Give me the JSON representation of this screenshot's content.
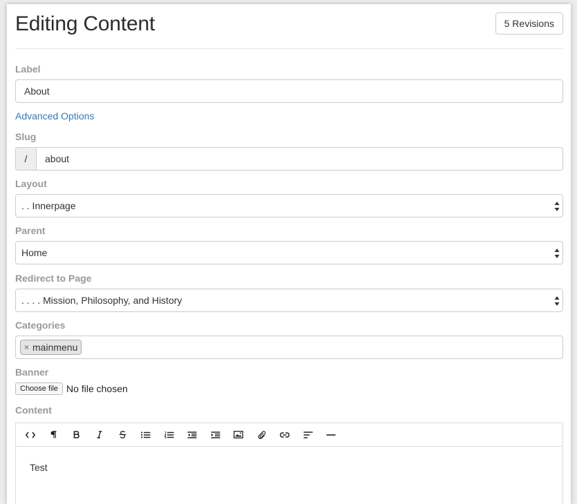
{
  "header": {
    "title": "Editing Content",
    "revisions_label": "5 Revisions"
  },
  "form": {
    "label": {
      "label": "Label",
      "value": "About"
    },
    "advanced_options": "Advanced Options",
    "slug": {
      "label": "Slug",
      "prefix": "/",
      "value": "about"
    },
    "layout": {
      "label": "Layout",
      "selected": ". . Innerpage"
    },
    "parent": {
      "label": "Parent",
      "selected": "Home"
    },
    "redirect": {
      "label": "Redirect to Page",
      "selected": ". . . . Mission, Philosophy, and History"
    },
    "categories": {
      "label": "Categories",
      "tags": [
        {
          "text": "mainmenu",
          "remove": "×"
        }
      ]
    },
    "banner": {
      "label": "Banner",
      "button": "Choose file",
      "status": "No file chosen"
    },
    "content": {
      "label": "Content",
      "body": "Test",
      "toolbar": [
        "code-icon",
        "paragraph-icon",
        "bold-icon",
        "italic-icon",
        "strikethrough-icon",
        "unordered-list-icon",
        "ordered-list-icon",
        "outdent-icon",
        "indent-icon",
        "image-icon",
        "attachment-icon",
        "link-icon",
        "align-left-icon",
        "horizontal-rule-icon"
      ]
    }
  },
  "colors": {
    "link": "#337ab7",
    "label": "#999999",
    "border": "#cccccc"
  }
}
